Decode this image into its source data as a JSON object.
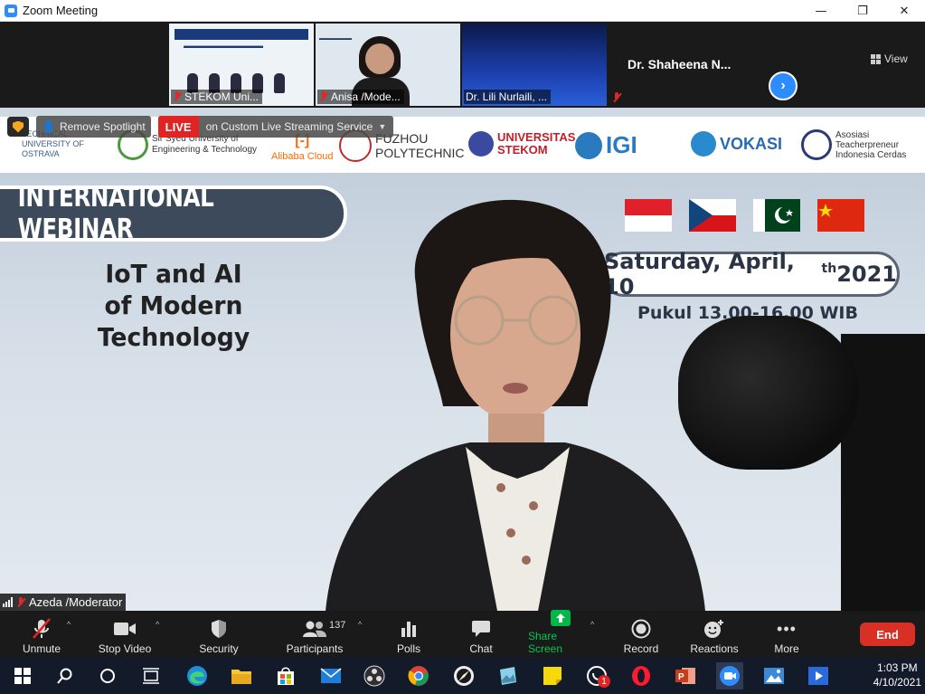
{
  "window": {
    "title": "Zoom Meeting",
    "minimize": "—",
    "restore": "❐",
    "close": "✕"
  },
  "thumbnails": [
    {
      "name": "STEKOM Uni..."
    },
    {
      "name": "Anisa /Mode..."
    },
    {
      "name": "Dr. Lili Nurlaili, ..."
    },
    {
      "name": "Dr. Shaheena N..."
    }
  ],
  "view_label": "View",
  "overlay": {
    "spotlight_label": "Remove Spotlight",
    "live_badge": "LIVE",
    "live_text": "on Custom Live Streaming Service"
  },
  "logos": [
    {
      "text": "TECHNICAL UNIVERSITY OF OSTRAVA"
    },
    {
      "text": "Sir Syed University of Engineering & Technology"
    },
    {
      "text": "Alibaba Cloud"
    },
    {
      "text": "FUZHOU POLYTECHNIC"
    },
    {
      "text": "UNIVERSITAS STEKOM"
    },
    {
      "text": "IGI"
    },
    {
      "text": "VOKASI"
    },
    {
      "text": "Asosiasi Teacherpreneur Indonesia Cerdas"
    }
  ],
  "slide": {
    "tag": "INTERNATIONAL WEBINAR",
    "headline_line1": "IoT and AI",
    "headline_line2": "of Modern Technology",
    "date_main": "Saturday, April, 10",
    "date_sup": "th",
    "date_year": " 2021",
    "time": "Pukul 13.00-16.00 WIB"
  },
  "speaker_name": "Azeda /Moderator",
  "toolbar": {
    "unmute": "Unmute",
    "stop_video": "Stop Video",
    "security": "Security",
    "participants": "Participants",
    "participants_count": "137",
    "polls": "Polls",
    "chat": "Chat",
    "share_screen": "Share Screen",
    "record": "Record",
    "reactions": "Reactions",
    "more": "More",
    "end": "End"
  },
  "taskbar": {
    "time": "1:03 PM",
    "date": "4/10/2021",
    "whatsapp_badge": "1"
  },
  "colors": {
    "zoom_blue": "#2d8cff",
    "end_red": "#d93025",
    "share_green": "#00b848",
    "live_red": "#e02424"
  }
}
